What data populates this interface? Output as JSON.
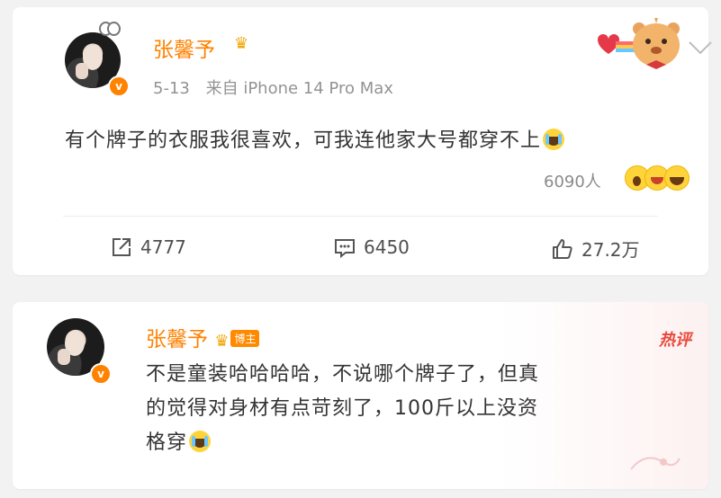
{
  "post": {
    "author": "张馨予",
    "date": "5-13",
    "source": "来自 iPhone 14 Pro Max",
    "text": "有个牌子的衣服我很喜欢，可我连他家大号都穿不上",
    "reaction_count": "6090人",
    "actions": {
      "repost_count": "4777",
      "comment_count": "6450",
      "like_count": "27.2万"
    }
  },
  "comment": {
    "author": "张馨予",
    "tag": "博主",
    "hot_label": "热评",
    "line1": "不是童装哈哈哈哈，不说哪个牌子了，但真",
    "line2": "的觉得对身材有点苛刻了，100斤以上没资",
    "line3": "格穿"
  },
  "icons": [
    "avatar",
    "verified-badge",
    "crown-icon",
    "chevron-down-icon",
    "cry-emoji",
    "repost-icon",
    "comment-icon",
    "like-icon"
  ],
  "colors": {
    "accent": "#ff8200",
    "hot": "#e94a3d",
    "text": "#333333",
    "meta": "#939393"
  }
}
